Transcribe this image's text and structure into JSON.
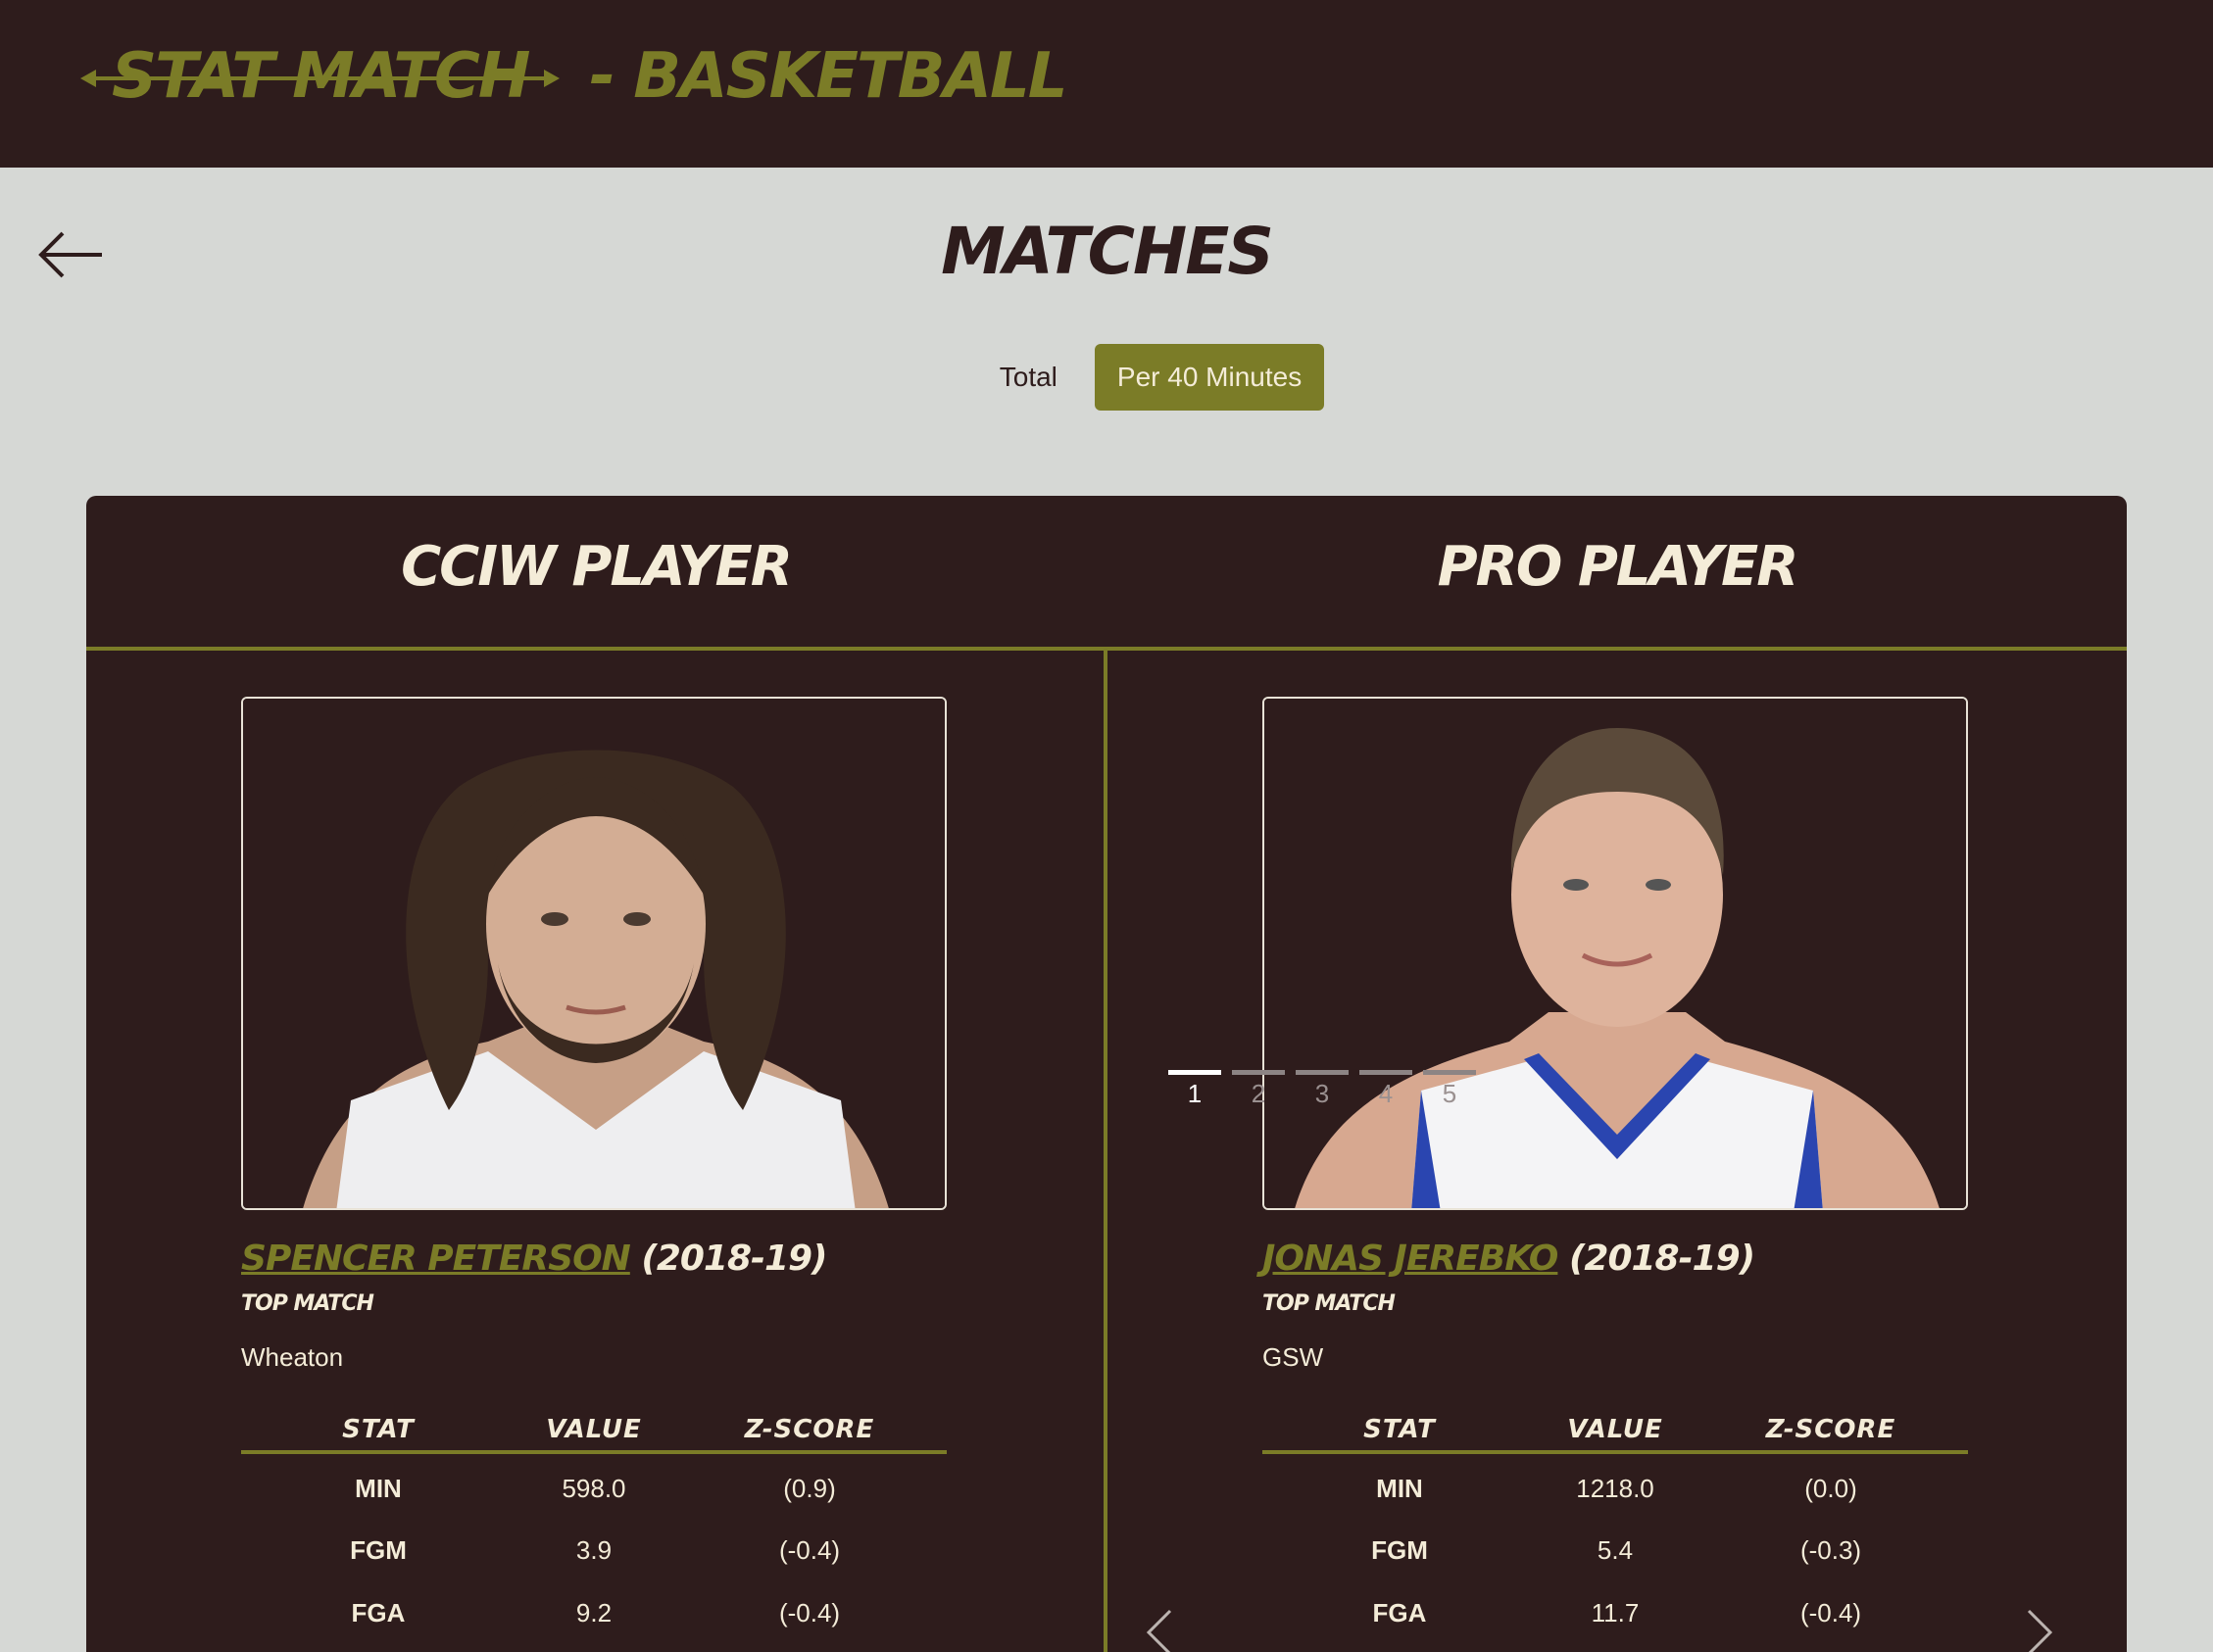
{
  "header": {
    "logo_text": "STAT MATCH",
    "sport_label": "- BASKETBALL"
  },
  "page": {
    "title": "MATCHES",
    "back_icon": "arrow-left-icon"
  },
  "toggle": {
    "options": [
      "Total",
      "Per 40 Minutes"
    ],
    "selected": "Per 40 Minutes"
  },
  "colors": {
    "header_bg": "#2e1c1c",
    "accent": "#7b7c27",
    "page_bg": "#d6d8d5",
    "text_light": "#f4ecd8"
  },
  "cciw": {
    "heading": "CCIW PLAYER",
    "name": "SPENCER PETERSON",
    "season": "(2018-19)",
    "tag": "TOP MATCH",
    "team": "Wheaton",
    "photo_icon": "player-photo",
    "stats_headers": [
      "STAT",
      "VALUE",
      "Z-SCORE"
    ],
    "stats": [
      {
        "stat": "MIN",
        "value": "598.0",
        "z": "(0.9)"
      },
      {
        "stat": "FGM",
        "value": "3.9",
        "z": "(-0.4)"
      },
      {
        "stat": "FGA",
        "value": "9.2",
        "z": "(-0.4)"
      }
    ]
  },
  "pro": {
    "heading": "PRO PLAYER",
    "name": "JONAS JEREBKO",
    "season": "(2018-19)",
    "tag": "TOP MATCH",
    "team": "GSW",
    "photo_icon": "player-photo",
    "pages": [
      "1",
      "2",
      "3",
      "4",
      "5"
    ],
    "active_page": "1",
    "stats_headers": [
      "STAT",
      "VALUE",
      "Z-SCORE"
    ],
    "stats": [
      {
        "stat": "MIN",
        "value": "1218.0",
        "z": "(0.0)"
      },
      {
        "stat": "FGM",
        "value": "5.4",
        "z": "(-0.3)"
      },
      {
        "stat": "FGA",
        "value": "11.7",
        "z": "(-0.4)"
      }
    ]
  }
}
